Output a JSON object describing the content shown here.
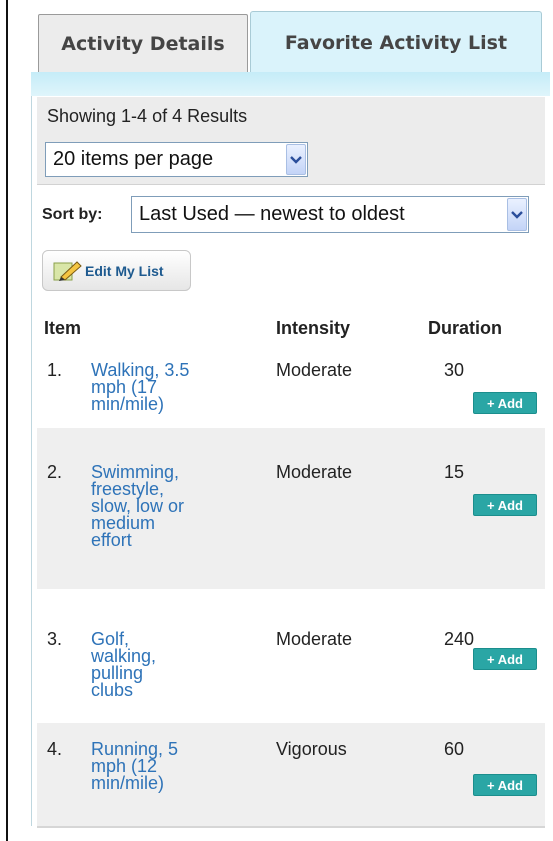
{
  "tabs": [
    {
      "label": "Activity Details",
      "active": false
    },
    {
      "label": "Favorite Activity List",
      "active": true
    }
  ],
  "results": {
    "showing_text": "Showing 1-4 of 4 Results",
    "per_page_value": "20 items per page"
  },
  "sort": {
    "label": "Sort by:",
    "value": "Last Used — newest to oldest"
  },
  "edit_button_label": "Edit My List",
  "table": {
    "headers": {
      "item": "Item",
      "intensity": "Intensity",
      "duration": "Duration"
    },
    "add_label": "+ Add",
    "rows": [
      {
        "num": "1.",
        "item_lines": [
          "Walking, 3.5",
          "mph (17",
          "min/mile)"
        ],
        "intensity": "Moderate",
        "duration": "30"
      },
      {
        "num": "2.",
        "item_lines": [
          "Swimming,",
          "freestyle,",
          "slow, low or",
          "medium",
          "effort"
        ],
        "intensity": "Moderate",
        "duration": "15"
      },
      {
        "num": "3.",
        "item_lines": [
          "Golf,",
          "walking,",
          "pulling",
          "clubs"
        ],
        "intensity": "Moderate",
        "duration": "240"
      },
      {
        "num": "4.",
        "item_lines": [
          "Running, 5",
          "mph (12",
          "min/mile)"
        ],
        "intensity": "Vigorous",
        "duration": "60"
      }
    ]
  },
  "icons": {
    "dropdown": "chevron-down-icon",
    "edit": "pencil-icon"
  },
  "colors": {
    "link": "#2e73b8",
    "add_button": "#2aa6a5",
    "active_tab": "#daf3fb"
  }
}
